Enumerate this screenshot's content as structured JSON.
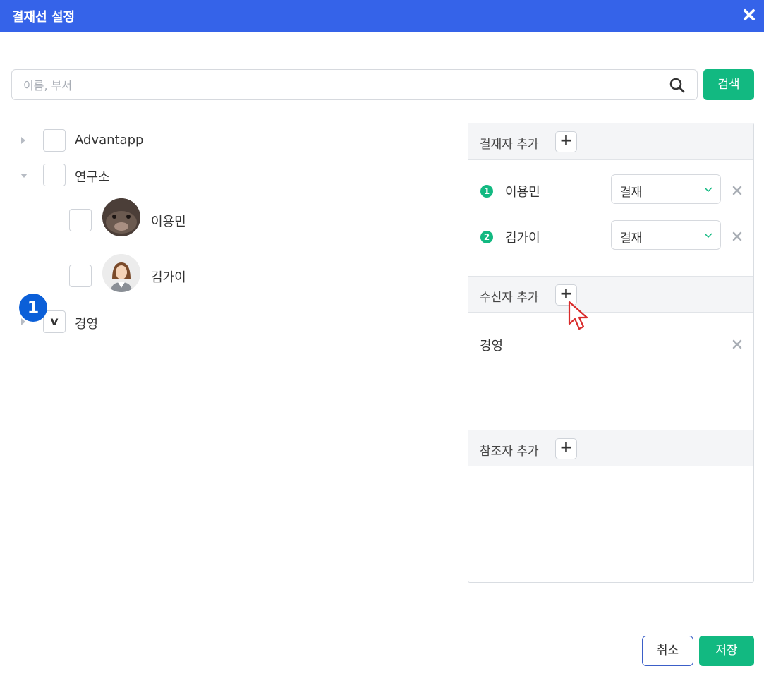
{
  "dialog": {
    "title": "결재선 설정"
  },
  "search": {
    "placeholder": "이름, 부서",
    "button_label": "검색"
  },
  "tree": {
    "nodes": [
      {
        "label": "Advantapp",
        "expanded": false,
        "checked": false
      },
      {
        "label": "연구소",
        "expanded": true,
        "checked": false
      },
      {
        "label": "이용민",
        "checked": false
      },
      {
        "label": "김가이",
        "checked": false
      },
      {
        "label": "경영",
        "expanded": false,
        "checked": true,
        "check_mark": "v"
      }
    ]
  },
  "step_badge": "1",
  "panel": {
    "approvers": {
      "header": "결재자 추가",
      "items": [
        {
          "order": "1",
          "name": "이용민",
          "type": "결재"
        },
        {
          "order": "2",
          "name": "김가이",
          "type": "결재"
        }
      ]
    },
    "receivers": {
      "header": "수신자 추가",
      "items": [
        {
          "name": "경영"
        }
      ]
    },
    "references": {
      "header": "참조자 추가",
      "items": []
    }
  },
  "footer": {
    "cancel_label": "취소",
    "save_label": "저장"
  },
  "colors": {
    "title_bar": "#3563e9",
    "primary_green": "#12b981",
    "badge_blue": "#0b5fd8"
  }
}
